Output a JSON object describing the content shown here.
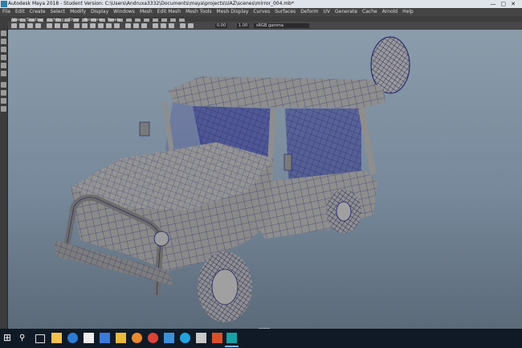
{
  "window": {
    "title": "Autodesk Maya 2018 - Student Version: C:\\Users\\Andruxa3332\\Documents\\maya\\projects\\UAZ\\scenes\\mirror_004.mb*"
  },
  "menus": [
    "File",
    "Edit",
    "Create",
    "Select",
    "Modify",
    "Display",
    "Windows",
    "Mesh",
    "Edit Mesh",
    "Mesh Tools",
    "Mesh Display",
    "Curves",
    "Surfaces",
    "Deform",
    "UV",
    "Generate",
    "Cache",
    "Arnold",
    "Help"
  ],
  "panel_menus": [
    "View",
    "Shading",
    "Lighting",
    "Show",
    "Renderer",
    "Panels"
  ],
  "panel_toolbar": {
    "field1": "0.00",
    "field2": "1.00",
    "color_space": "sRGB gamma"
  },
  "viewport": {
    "camera_label": "persp"
  },
  "taskbar": {
    "icons": [
      "windows-start-icon",
      "search-icon",
      "task-view-icon",
      "file-explorer-icon",
      "edge-icon",
      "store-icon",
      "mail-icon",
      "explorer-folder-icon",
      "firefox-icon",
      "chrome-icon",
      "photos-icon",
      "skype-icon",
      "media-icon",
      "paint-icon",
      "maya-icon"
    ]
  },
  "colors": {
    "title_bar": "#dfe3ea",
    "ui_dark": "#444444",
    "viewport_top": "#8b9cab",
    "viewport_bottom": "#5b6a79",
    "mesh_fill": "#8e8e8e",
    "wireframe": "#1a1a66",
    "taskbar": "#101a26"
  }
}
